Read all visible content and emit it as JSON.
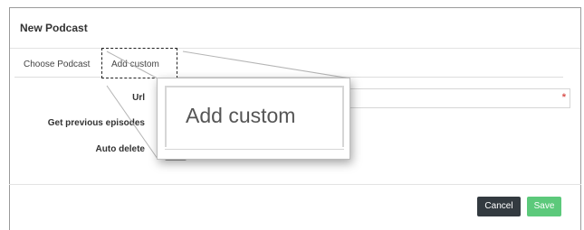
{
  "dialog": {
    "title": "New Podcast"
  },
  "tabs": [
    {
      "label": "Choose Podcast"
    },
    {
      "label": "Add custom"
    }
  ],
  "form": {
    "url_label": "Url",
    "url_required": "*",
    "get_previous_label": "Get previous episodes",
    "auto_delete_label": "Auto delete"
  },
  "footer": {
    "cancel_label": "Cancel",
    "save_label": "Save"
  },
  "zoom": {
    "text": "Add custom"
  },
  "colors": {
    "cancel_bg": "#333a40",
    "save_bg": "#5cc97b",
    "required": "#d9534f"
  }
}
